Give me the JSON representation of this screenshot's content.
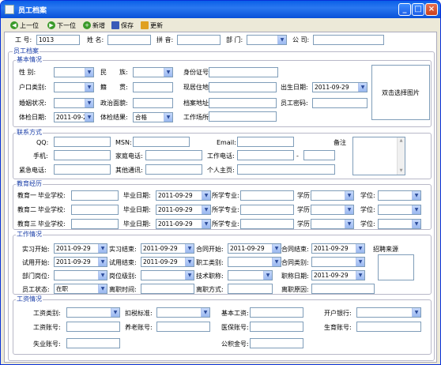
{
  "window": {
    "title": "员工档案"
  },
  "toolbar": {
    "prev": "上一位",
    "next": "下一位",
    "add": "新增",
    "save": "保存",
    "update": "更新"
  },
  "header": {
    "emp_no_label": "工 号:",
    "emp_no": "1013",
    "name_label": "姓 名:",
    "pinyin_label": "拼 音:",
    "dept_label": "部 门:",
    "company_label": "公 司:"
  },
  "outer_title": "员工档案",
  "basic": {
    "title": "基本情况",
    "gender": "性 别:",
    "ethnic_a": "民",
    "ethnic_b": "族:",
    "idcard": "身份证号:",
    "hukou": "户口类别:",
    "origin_a": "籍",
    "origin_b": "贯:",
    "address": "现居住地:",
    "birth": "出生日期:",
    "birth_val": "2011-09-29",
    "marriage": "婚姻状况:",
    "political": "政治面貌:",
    "archive": "档案地址:",
    "password": "员工密码:",
    "physdate": "体检日期:",
    "physdate_val": "2011-09-29",
    "physresult": "体检结果:",
    "physresult_val": "合格",
    "workplace": "工作场所:",
    "photo": "双击选择图片"
  },
  "contact": {
    "title": "联系方式",
    "qq": "QQ:",
    "msn": "MSN:",
    "email": "Email:",
    "note": "备注",
    "mobile": "手机:",
    "homephone": "家庭电话:",
    "workphone": "工作电话:",
    "dash": "-",
    "emergency": "紧急电话:",
    "other": "其他通讯:",
    "homepage": "个人主页:"
  },
  "edu": {
    "title": "教育经历",
    "rows": [
      {
        "label": "教育一",
        "school": "毕业学校:",
        "date": "毕业日期:",
        "date_val": "2011-09-29",
        "major": "所学专业:",
        "degree": "学历:",
        "grade": "学位:"
      },
      {
        "label": "教育二",
        "school": "毕业学校:",
        "date": "毕业日期:",
        "date_val": "2011-09-29",
        "major": "所学专业:",
        "degree": "学历:",
        "grade": "学位:"
      },
      {
        "label": "教育三",
        "school": "毕业学校:",
        "date": "毕业日期:",
        "date_val": "2011-09-29",
        "major": "所学专业:",
        "degree": "学历:",
        "grade": "学位:"
      }
    ]
  },
  "work": {
    "title": "工作情况",
    "intern_start": "实习开始:",
    "intern_start_val": "2011-09-29",
    "intern_end": "实习结束:",
    "intern_end_val": "2011-09-29",
    "contract_start": "合同开始:",
    "contract_start_val": "2011-09-29",
    "contract_end": "合同结束:",
    "contract_end_val": "2011-09-29",
    "source": "招聘来源",
    "trial_start": "试用开始:",
    "trial_start_val": "2011-09-29",
    "trial_end": "试用结束:",
    "trial_end_val": "2011-09-29",
    "category": "职工类别:",
    "contract_type": "合同类别:",
    "dept_post": "部门岗位:",
    "post_level": "岗位级别:",
    "tech_title": "技术职称:",
    "title_date": "职称日期:",
    "title_date_val": "2011-09-29",
    "status": "员工状态:",
    "status_val": "在职",
    "leave_time": "离职时间:",
    "leave_way": "离职方式:",
    "leave_reason": "离职原因:"
  },
  "salary": {
    "title": "工资情况",
    "salary_type": "工资类别:",
    "tax_std": "扣税标准:",
    "base": "基本工资:",
    "bank": "开户银行:",
    "salary_acct": "工资账号:",
    "pension_acct": "养老账号:",
    "medical_acct": "医保账号:",
    "maternity_acct": "生育账号:",
    "unemploy_acct": "失业账号:",
    "fund_acct": "公积金号:"
  }
}
